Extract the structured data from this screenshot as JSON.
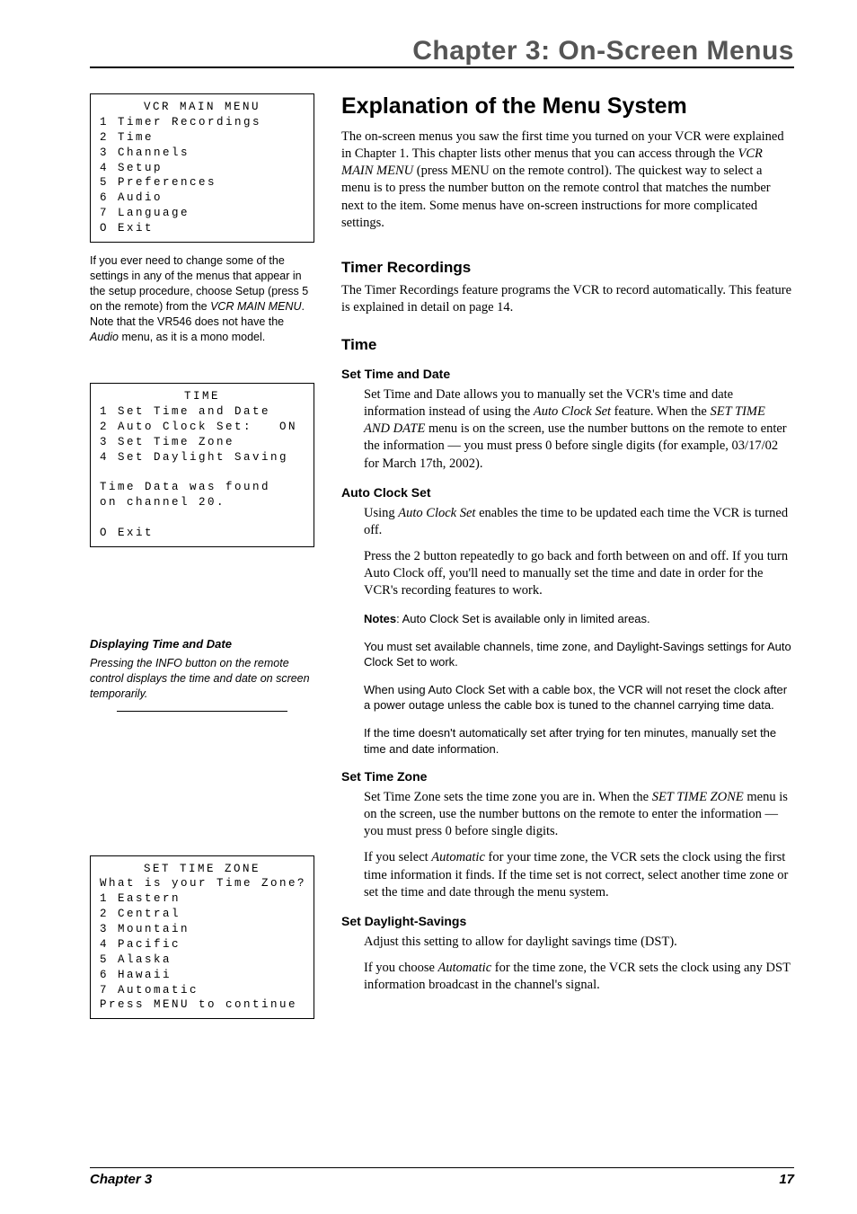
{
  "chapter_title": "Chapter 3: On-Screen Menus",
  "left": {
    "box1": {
      "title": "VCR MAIN MENU",
      "lines": [
        "1 Timer Recordings",
        "2 Time",
        "3 Channels",
        "4 Setup",
        "5 Preferences",
        "6 Audio",
        "7 Language",
        "O Exit"
      ]
    },
    "note1_parts": [
      "If you ever need to change some of the settings in any of the menus that appear in the setup procedure, choose Setup (press 5 on the remote) from the ",
      "VCR MAIN MENU",
      ". Note that the VR546 does not have the ",
      "Audio",
      " menu, as it is a mono model."
    ],
    "box2": {
      "title": "TIME",
      "lines_a": [
        "1 Set Time and Date",
        "2 Auto Clock Set:   ON",
        "3 Set Time Zone",
        "4 Set Daylight Saving"
      ],
      "lines_b": [
        "Time Data was found",
        "on channel 20."
      ],
      "lines_c": [
        "O Exit"
      ]
    },
    "tip_heading": "Displaying Time and Date",
    "tip_body": "Pressing the INFO button on the remote control displays the time and date on screen temporarily.",
    "box3": {
      "title": "SET TIME ZONE",
      "lines": [
        "What is your Time Zone?",
        "1 Eastern",
        "2 Central",
        "3 Mountain",
        "4 Pacific",
        "5 Alaska",
        "6 Hawaii",
        "7 Automatic",
        "Press MENU to continue"
      ]
    }
  },
  "right": {
    "h2": "Explanation of the Menu System",
    "p1_parts": [
      "The on-screen menus you saw the first time you turned on your VCR were explained in Chapter 1. This chapter lists other menus that you can access through the ",
      "VCR MAIN MENU",
      " (press MENU on the remote control). The quickest way to select a menu is to press the number button on the remote control that matches the number next to the item. Some menus have on-screen instructions for more complicated settings."
    ],
    "h3a": "Timer Recordings",
    "p2": "The Timer Recordings feature programs the VCR to record automatically. This feature is explained in detail on page 14.",
    "h3b": "Time",
    "h4a": "Set Time and Date",
    "p3_parts": [
      "Set Time and Date allows you to manually set the VCR's time and date information instead of using the ",
      "Auto Clock Set",
      " feature. When the ",
      "SET TIME AND DATE",
      " menu is on the screen, use the number buttons on the remote to enter the information — you must press 0 before single digits (for example, 03/17/02 for March 17th, 2002)."
    ],
    "h4b": "Auto Clock Set",
    "p4_parts": [
      "Using ",
      "Auto Clock Set",
      " enables the time to be updated each time the VCR is turned off."
    ],
    "p5": "Press the 2 button repeatedly to go back and forth between on and off. If you turn Auto Clock off, you'll need to manually set the time and date in order for the VCR's recording features to work.",
    "notes_label": "Notes",
    "note_a": ": Auto Clock Set is available only in limited areas.",
    "note_b": "You must set available channels, time zone, and Daylight-Savings settings for Auto Clock Set to work.",
    "note_c": "When using Auto Clock Set with a cable box, the VCR will not reset the clock after a power outage unless the cable box is tuned to the channel carrying time data.",
    "note_d": "If the time doesn't automatically set after trying for ten minutes, manually set the time and date information.",
    "h4c": "Set Time Zone",
    "p6_parts": [
      "Set Time Zone sets the time zone you are in. When the ",
      "SET TIME ZONE",
      " menu is on the screen, use the number buttons on the remote to enter the information — you must press 0 before single digits."
    ],
    "p7_parts": [
      "If you select ",
      "Automatic",
      " for your time zone, the VCR sets the clock using the first time information it finds. If the time set is not correct, select another time zone or set the time and date through the menu system."
    ],
    "h4d": "Set Daylight-Savings",
    "p8": "Adjust this setting to allow for daylight savings time (DST).",
    "p9_parts": [
      "If you choose ",
      "Automatic",
      " for the time zone, the VCR sets the clock using any DST information broadcast in the channel's signal."
    ]
  },
  "footer": {
    "left": "Chapter 3",
    "right": "17"
  }
}
